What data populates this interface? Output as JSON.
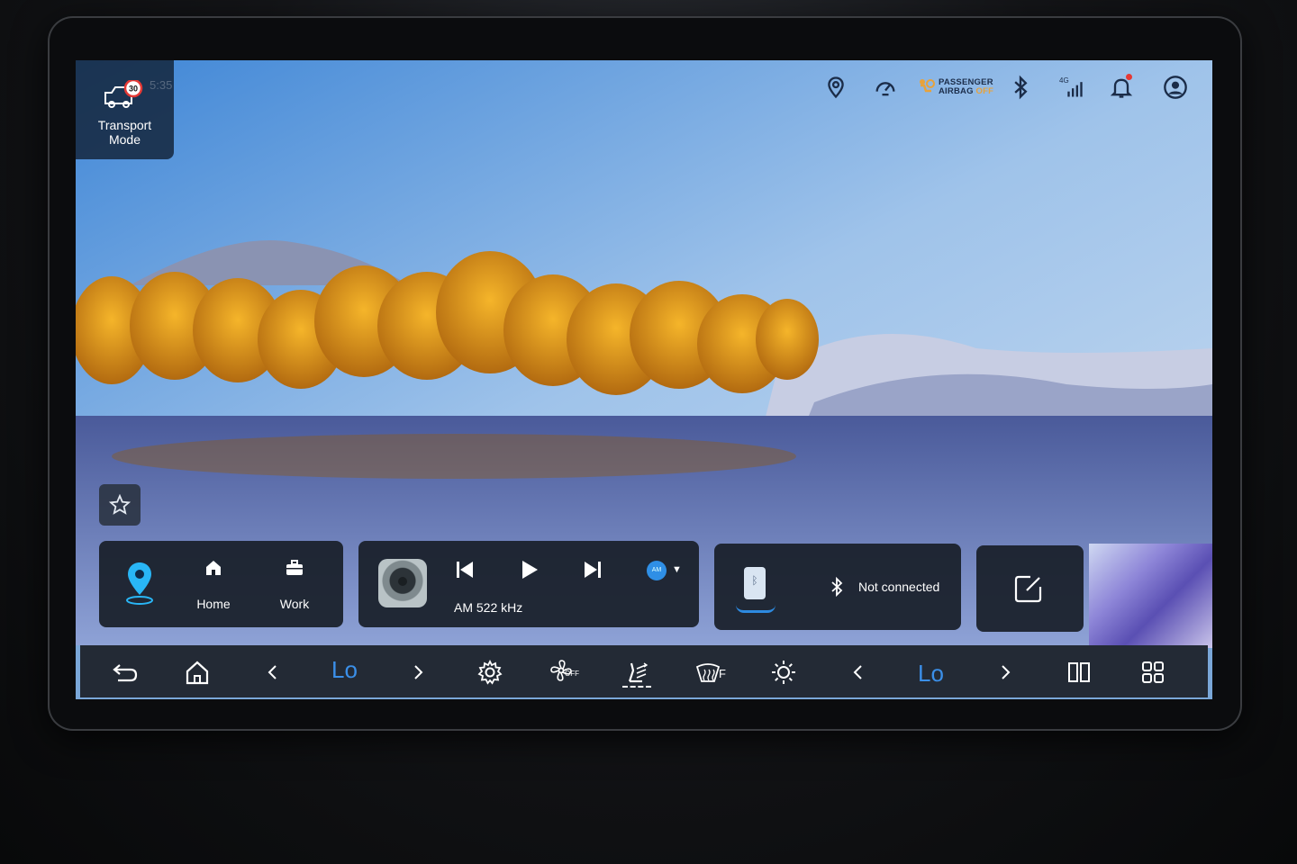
{
  "transport": {
    "label_line1": "Transport",
    "label_line2": "Mode",
    "speed_limit": "30",
    "time": "5:35"
  },
  "status_bar": {
    "icons": [
      "location-icon",
      "speedometer-icon",
      "airbag-icon",
      "bluetooth-icon",
      "cellular-signal-icon",
      "notification-icon",
      "user-profile-icon"
    ],
    "airbag_line1": "PASSENGER",
    "airbag_line2": "AIRBAG",
    "airbag_state": "OFF",
    "network": "4G"
  },
  "nav_card": {
    "home_label": "Home",
    "work_label": "Work"
  },
  "media_card": {
    "station": "AM 522 kHz",
    "source": "AM"
  },
  "phone_card": {
    "status": "Not connected"
  },
  "dock": {
    "left_temp": "Lo",
    "right_temp": "Lo",
    "fan_state": "OFF",
    "defrost_label": "F"
  },
  "colors": {
    "accent": "#3b8fe8",
    "card_bg": "#181e28",
    "dock_bg": "#232a35",
    "speed_limit_red": "#e53935"
  }
}
